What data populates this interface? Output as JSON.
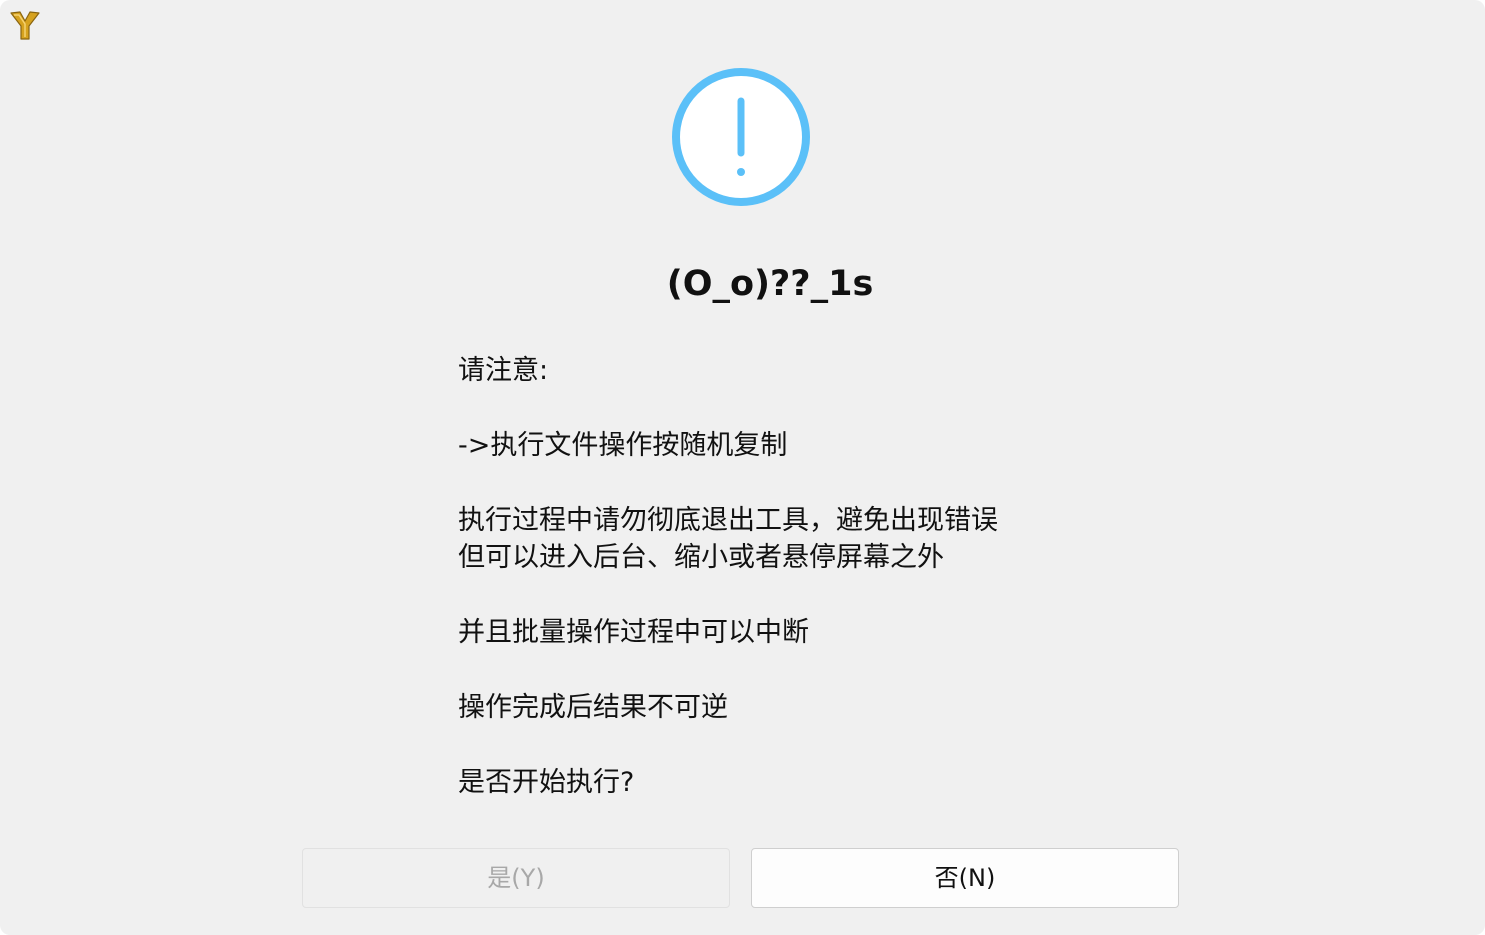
{
  "dialog": {
    "app_icon": "y-logo-icon",
    "status_icon": "exclamation-circle-icon",
    "title": "(O_o)??_1s",
    "message_lines": [
      "请注意:",
      "->执行文件操作按随机复制",
      "执行过程中请勿彻底退出工具，避免出现错误",
      "但可以进入后台、缩小或者悬停屏幕之外",
      "并且批量操作过程中可以中断",
      "操作完成后结果不可逆",
      "是否开始执行?"
    ],
    "buttons": {
      "yes_label": "是(Y)",
      "no_label": "否(N)"
    }
  },
  "colors": {
    "background": "#f0f0f0",
    "accent": "#5bc0f8",
    "logo": "#d6a21f",
    "disabled_text": "#a8a8a8"
  }
}
